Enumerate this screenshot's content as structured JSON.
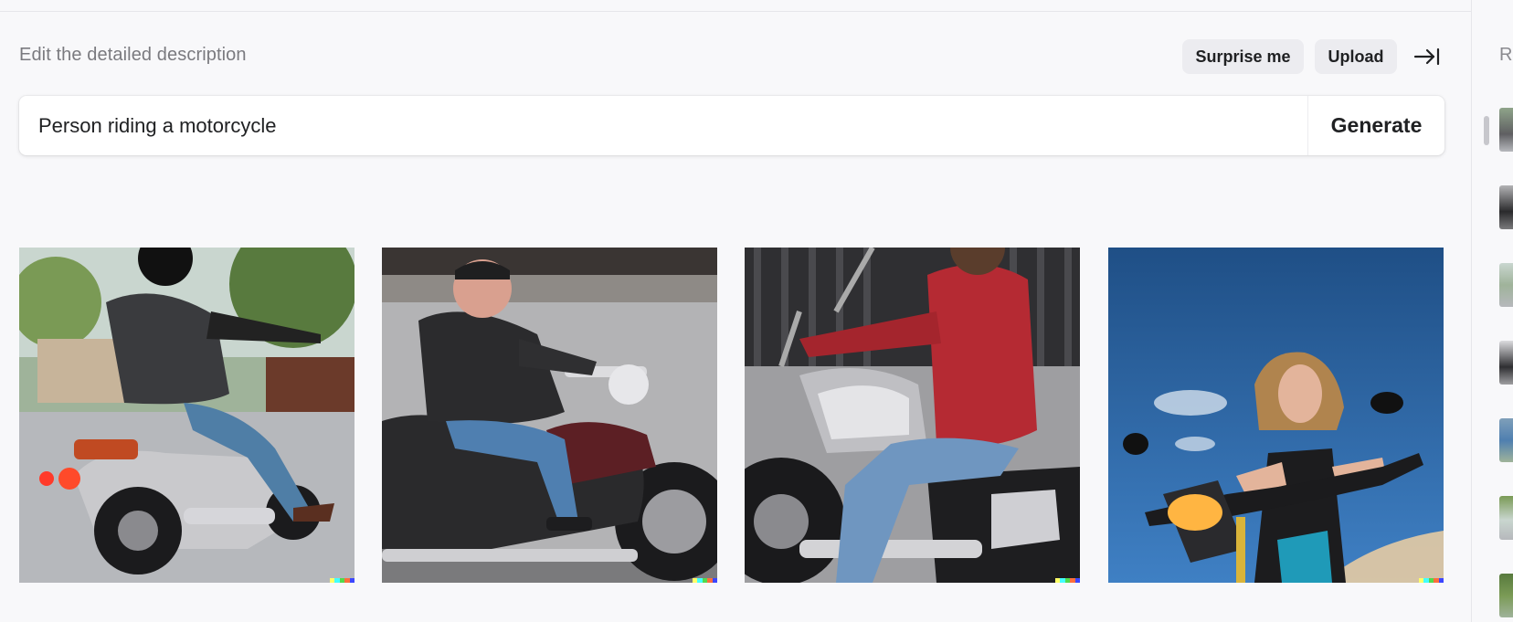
{
  "header": {
    "instructions": "Edit the detailed description",
    "surprise_label": "Surprise me",
    "upload_label": "Upload"
  },
  "prompt": {
    "value": "Person riding a motorcycle",
    "generate_label": "Generate"
  },
  "results": [
    {
      "subject": "rider-leather-vest-street"
    },
    {
      "subject": "older-man-leather-jacket"
    },
    {
      "subject": "man-red-shirt-motorcycle"
    },
    {
      "subject": "woman-motorcycle-blue-sky"
    }
  ],
  "sidebar": {
    "title": "R",
    "thumb_count": 7
  },
  "colors": {
    "background": "#f8f8fa",
    "chip": "#ececf0",
    "text": "#202123",
    "muted": "#7a7a7f",
    "watermark": [
      "#ffff66",
      "#42ffff",
      "#51da4c",
      "#ff6e3c",
      "#3c46ff"
    ]
  }
}
